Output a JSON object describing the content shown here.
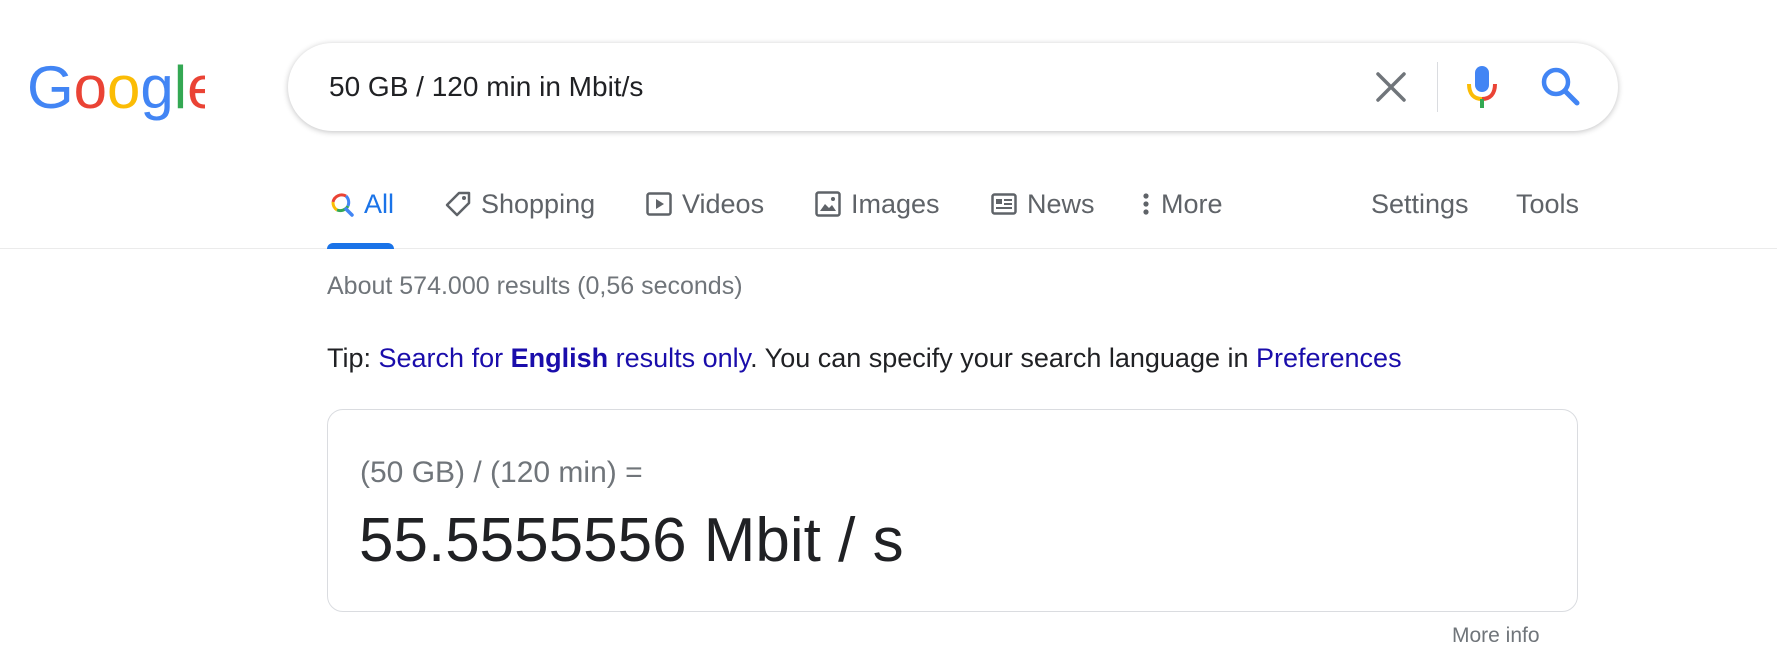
{
  "logo": {
    "text": "Google",
    "colors": [
      "#4285F4",
      "#EA4335",
      "#FBBC05",
      "#4285F4",
      "#34A853",
      "#EA4335"
    ]
  },
  "search": {
    "query": "50 GB / 120 min in Mbit/s"
  },
  "icons": {
    "clear": "close-icon",
    "mic": "microphone-icon",
    "search": "search-icon"
  },
  "tabs": [
    {
      "label": "All",
      "icon": "search-icon",
      "active": true
    },
    {
      "label": "Shopping",
      "icon": "tag-icon"
    },
    {
      "label": "Videos",
      "icon": "play-icon"
    },
    {
      "label": "Images",
      "icon": "image-icon"
    },
    {
      "label": "News",
      "icon": "newspaper-icon"
    },
    {
      "label": "More",
      "icon": "kebab-icon"
    },
    {
      "label": "Settings"
    },
    {
      "label": "Tools"
    }
  ],
  "result_stats": "About 574.000 results (0,56 seconds)",
  "tip": {
    "prefix": "Tip: ",
    "link_pre": "Search for ",
    "link_bold": "English",
    "link_post": " results only",
    "middle": ". You can specify your search language in ",
    "pref_link": "Preferences"
  },
  "calculator": {
    "expression": "(50 GB) / (120 min) =",
    "result": "55.5555556 Mbit / s"
  },
  "more_info": "More info",
  "colors": {
    "accent": "#1a73e8",
    "link": "#1a0dab",
    "text": "#202124",
    "muted": "#70757a"
  }
}
